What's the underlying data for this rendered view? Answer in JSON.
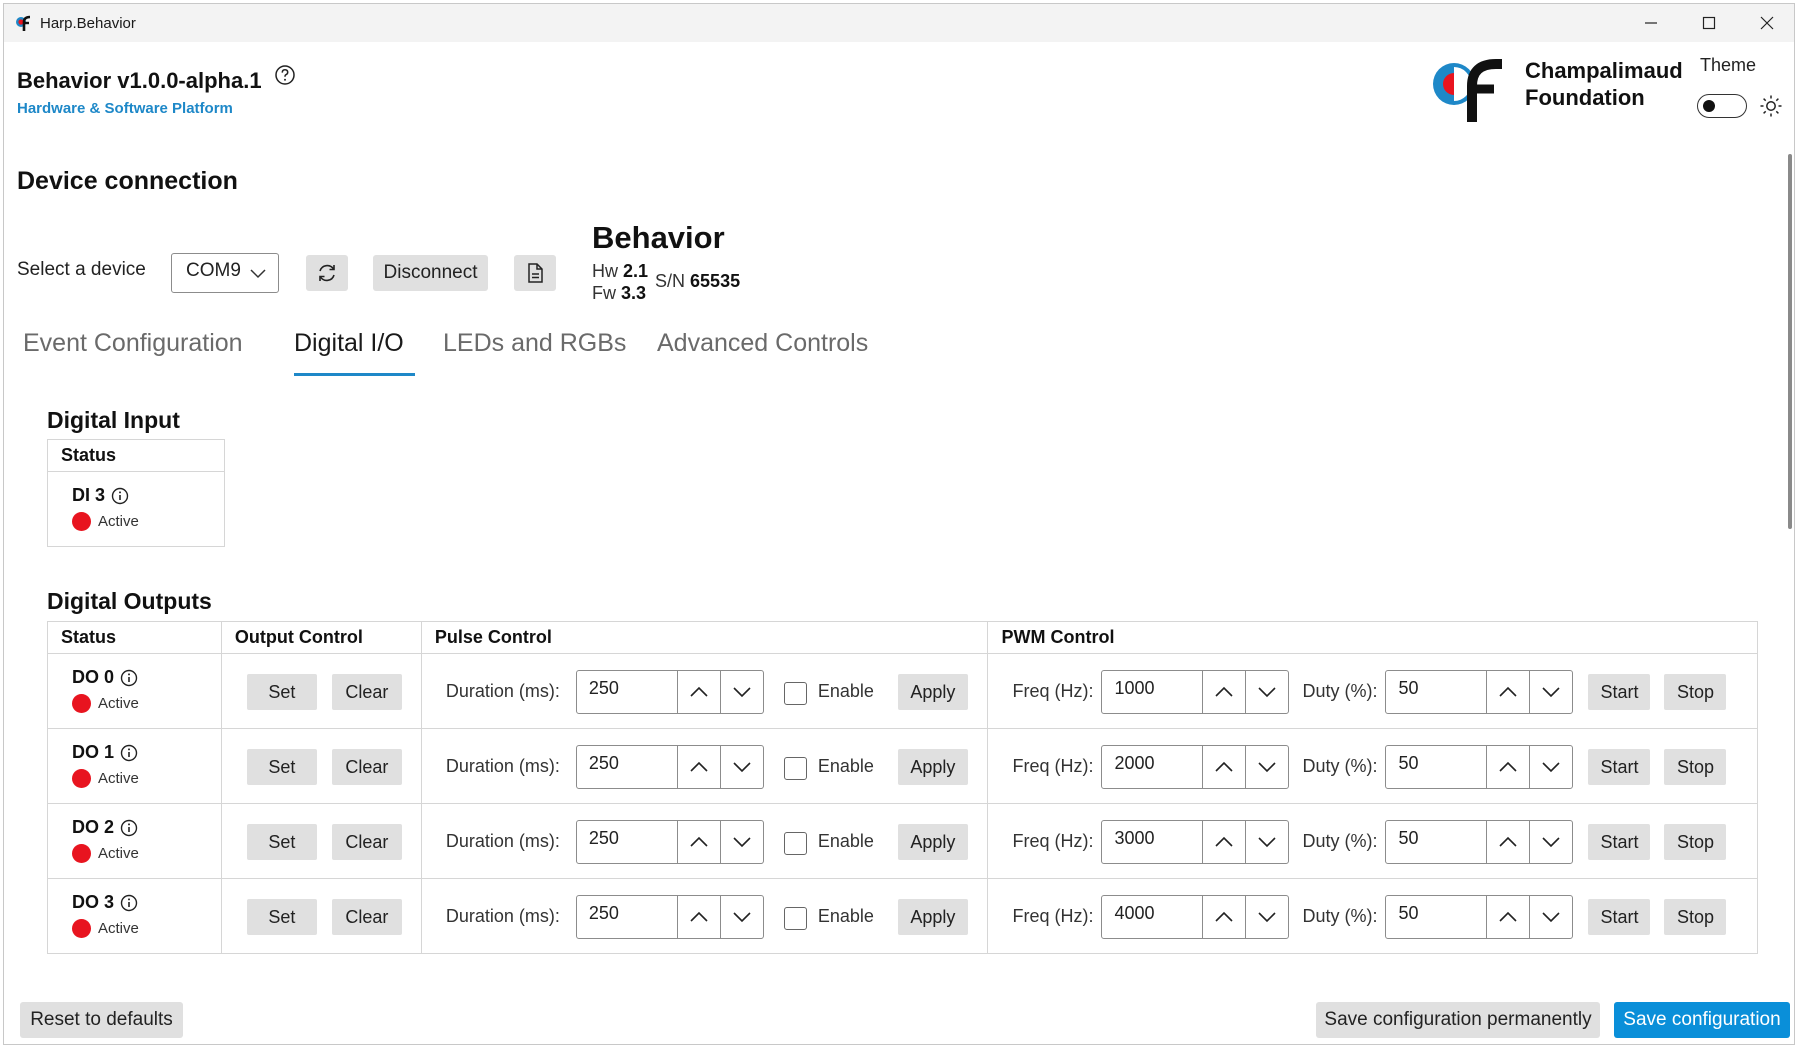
{
  "window": {
    "title": "Harp.Behavior"
  },
  "header": {
    "app_name": "Behavior v1.0.0-alpha.1",
    "subtitle": "Hardware & Software Platform",
    "logo_line1": "Champalimaud",
    "logo_line2": "Foundation",
    "theme_label": "Theme",
    "theme_dark": false
  },
  "connection": {
    "section_title": "Device connection",
    "select_label": "Select a device",
    "selected_port": "COM9",
    "disconnect_label": "Disconnect",
    "device_name": "Behavior",
    "hw_label": "Hw",
    "hw_value": "2.1",
    "fw_label": "Fw",
    "fw_value": "3.3",
    "sn_label": "S/N",
    "sn_value": "65535"
  },
  "tabs": [
    {
      "label": "Event Configuration",
      "active": false
    },
    {
      "label": "Digital I/O",
      "active": true
    },
    {
      "label": "LEDs and RGBs",
      "active": false
    },
    {
      "label": "Advanced Controls",
      "active": false
    }
  ],
  "digital_input": {
    "title": "Digital Input",
    "status_header": "Status",
    "channel": {
      "name": "DI 3",
      "status": "Active"
    }
  },
  "digital_outputs": {
    "title": "Digital Outputs",
    "headers": {
      "status": "Status",
      "output_control": "Output Control",
      "pulse_control": "Pulse Control",
      "pwm_control": "PWM Control"
    },
    "labels": {
      "set": "Set",
      "clear": "Clear",
      "duration": "Duration (ms):",
      "enable": "Enable",
      "apply": "Apply",
      "freq": "Freq (Hz):",
      "duty": "Duty (%):",
      "start": "Start",
      "stop": "Stop"
    },
    "rows": [
      {
        "name": "DO 0",
        "status": "Active",
        "duration": "250",
        "enabled": false,
        "freq": "1000",
        "duty": "50"
      },
      {
        "name": "DO 1",
        "status": "Active",
        "duration": "250",
        "enabled": false,
        "freq": "2000",
        "duty": "50"
      },
      {
        "name": "DO 2",
        "status": "Active",
        "duration": "250",
        "enabled": false,
        "freq": "3000",
        "duty": "50"
      },
      {
        "name": "DO 3",
        "status": "Active",
        "duration": "250",
        "enabled": false,
        "freq": "4000",
        "duty": "50"
      }
    ]
  },
  "footer": {
    "reset_label": "Reset to defaults",
    "save_permanent_label": "Save configuration permanently",
    "save_label": "Save configuration"
  },
  "colors": {
    "accent": "#0a8fd9",
    "tab_underline": "#1e88c8",
    "status_active": "#e8141f",
    "button_gray": "#e0e0e0"
  },
  "icons": {
    "refresh": "refresh-icon",
    "document": "document-icon",
    "help": "help-icon",
    "info": "info-icon",
    "theme": "sun-icon"
  }
}
